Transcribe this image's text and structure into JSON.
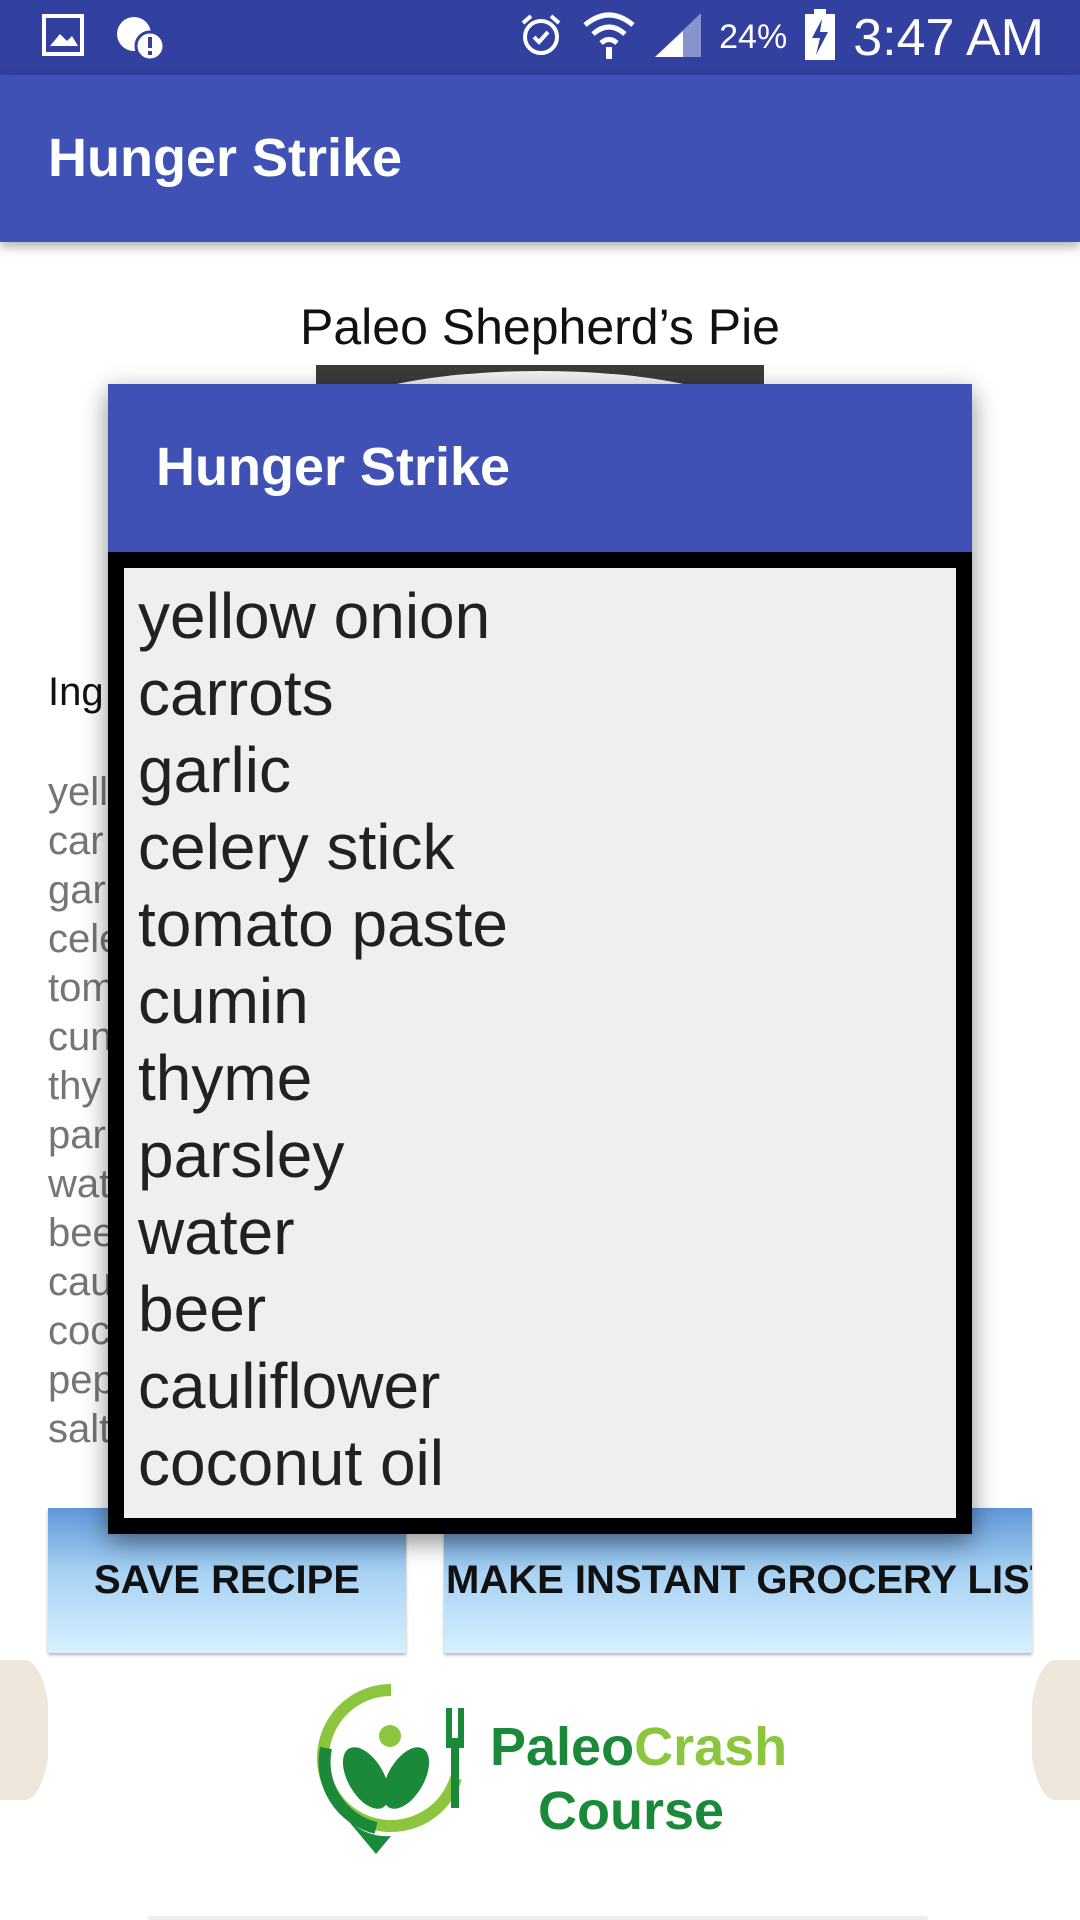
{
  "status_bar": {
    "icons_left": [
      "gallery-icon",
      "location-alert-icon"
    ],
    "icons_right": [
      "alarm-icon",
      "wifi-icon",
      "signal-icon",
      "battery-charging-icon"
    ],
    "battery_percent": "24%",
    "time": "3:47 AM"
  },
  "toolbar": {
    "title": "Hunger Strike"
  },
  "recipe": {
    "title": "Paleo Shepherd’s Pie",
    "ingredients_label": "Ing",
    "ingredients_visible": [
      "yell",
      "car",
      "gar",
      "cele",
      "tom",
      "cun",
      "thy",
      "par",
      "wat",
      "bee",
      "cau",
      "coc",
      "pep",
      "salt"
    ]
  },
  "buttons": {
    "save_label": "SAVE RECIPE",
    "grocery_label": "MAKE INSTANT GROCERY LIST"
  },
  "logo": {
    "text_paleo": "Paleo",
    "text_crash": "Crash",
    "text_course": "Course"
  },
  "dialog": {
    "title": "Hunger Strike",
    "items": [
      "yellow onion",
      "carrots",
      "garlic",
      "celery stick",
      "tomato paste",
      "cumin",
      "thyme",
      "parsley",
      "water",
      "beer",
      "cauliflower",
      "coconut oil"
    ]
  },
  "colors": {
    "status_bar": "#3240a0",
    "primary": "#3f51b5",
    "logo_green": "#1a8a3a",
    "logo_lime": "#8cc63f"
  }
}
